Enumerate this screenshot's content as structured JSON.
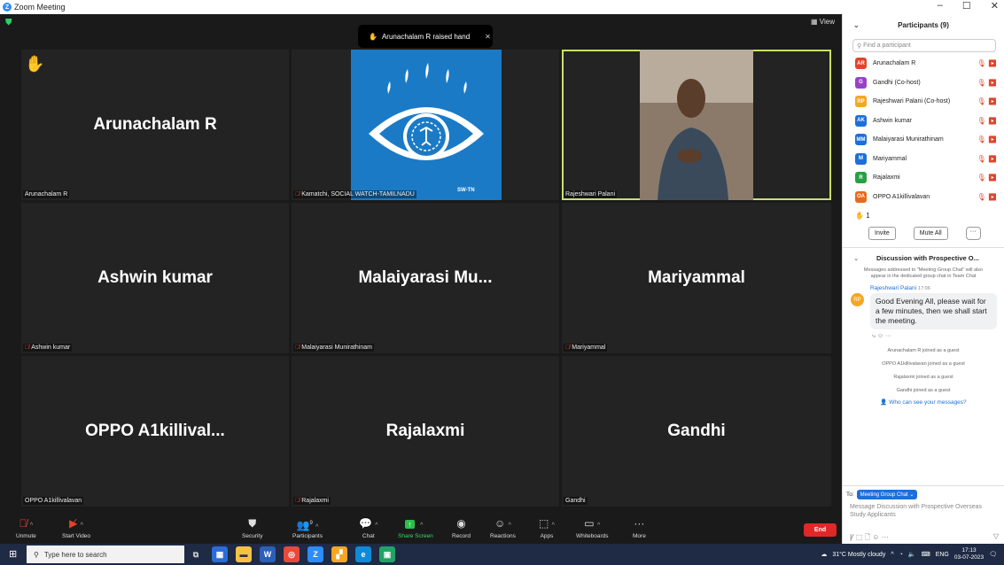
{
  "window": {
    "title": "Zoom Meeting",
    "controls": [
      "–",
      "☐",
      "✕"
    ]
  },
  "stage": {
    "view_label": "View",
    "toast": "Arunachalam R raised hand",
    "tiles": [
      {
        "big": "Arunachalam R",
        "label": "Arunachalam R",
        "muted": false,
        "hand": true
      },
      {
        "big": "",
        "label": "Kamatchi, SOCIAL WATCH-TAMILNADU",
        "muted": true,
        "logo_text": "SW-TN"
      },
      {
        "big": "",
        "label": "Rajeshwari Palani",
        "muted": false,
        "video": true
      },
      {
        "big": "Ashwin kumar",
        "label": "Ashwin kumar",
        "muted": true
      },
      {
        "big": "Malaiyarasi  Mu...",
        "label": "Malaiyarasi Munirathinam",
        "muted": true
      },
      {
        "big": "Mariyammal",
        "label": "Mariyammal",
        "muted": true
      },
      {
        "big": "OPPO  A1killival...",
        "label": "OPPO A1killivalavan",
        "muted": false
      },
      {
        "big": "Rajalaxmi",
        "label": "Rajalaxmi",
        "muted": true
      },
      {
        "big": "Gandhi",
        "label": "Gandhi",
        "muted": false
      }
    ]
  },
  "toolbar": {
    "unmute": "Unmute",
    "start_video": "Start Video",
    "security": "Security",
    "participants": "Participants",
    "participants_count": "9",
    "chat": "Chat",
    "share": "Share Screen",
    "record": "Record",
    "reactions": "Reactions",
    "apps": "Apps",
    "whiteboards": "Whiteboards",
    "more": "More",
    "end": "End"
  },
  "panel": {
    "title": "Participants (9)",
    "search_placeholder": "Find a participant",
    "participants": [
      {
        "initials": "AR",
        "name": "Arunachalam R",
        "color": "#e0452b"
      },
      {
        "initials": "G",
        "name": "Gandhi (Co-host)",
        "color": "#9b3fc9"
      },
      {
        "initials": "RP",
        "name": "Rajeshwari Palani (Co-host)",
        "color": "#f5a623"
      },
      {
        "initials": "AK",
        "name": "Ashwin kumar",
        "color": "#1d6fd9"
      },
      {
        "initials": "MM",
        "name": "Malaiyarasi Munirathinam",
        "color": "#1d6fd9"
      },
      {
        "initials": "M",
        "name": "Mariyammal",
        "color": "#1d6fd9"
      },
      {
        "initials": "R",
        "name": "Rajalaxmi",
        "color": "#27a046"
      },
      {
        "initials": "OA",
        "name": "OPPO A1killivalavan",
        "color": "#e86a1a"
      }
    ],
    "hand_count": "1",
    "invite": "Invite",
    "mute_all": "Mute All",
    "more_dots": "···"
  },
  "chat": {
    "title": "Discussion with Prospective O...",
    "note": "Messages addressed to \"Meeting Group Chat\" will also appear in the dedicated group chat in Team Chat",
    "sender": "Rajeshwari Palani",
    "time": "17:06",
    "avatar": "RP",
    "message": "Good Evening All, please wait for a few minutes, then we shall start the meeting.",
    "system": [
      "Arunachalam R joined as a guest",
      "OPPO A1killivalavan joined as a guest",
      "Rajalaxmi joined as a guest",
      "Gandhi joined as a guest"
    ],
    "who_can_see": "Who can see your messages?",
    "to_label": "To:",
    "to_chip": "Meeting Group Chat ⌄",
    "input_placeholder": "Message Discussion with Prospective Overseas Study Applicants"
  },
  "taskbar": {
    "search_placeholder": "Type here to search",
    "weather": "31°C  Mostly cloudy",
    "lang": "ENG",
    "time": "17:13",
    "date": "03-07-2023"
  }
}
